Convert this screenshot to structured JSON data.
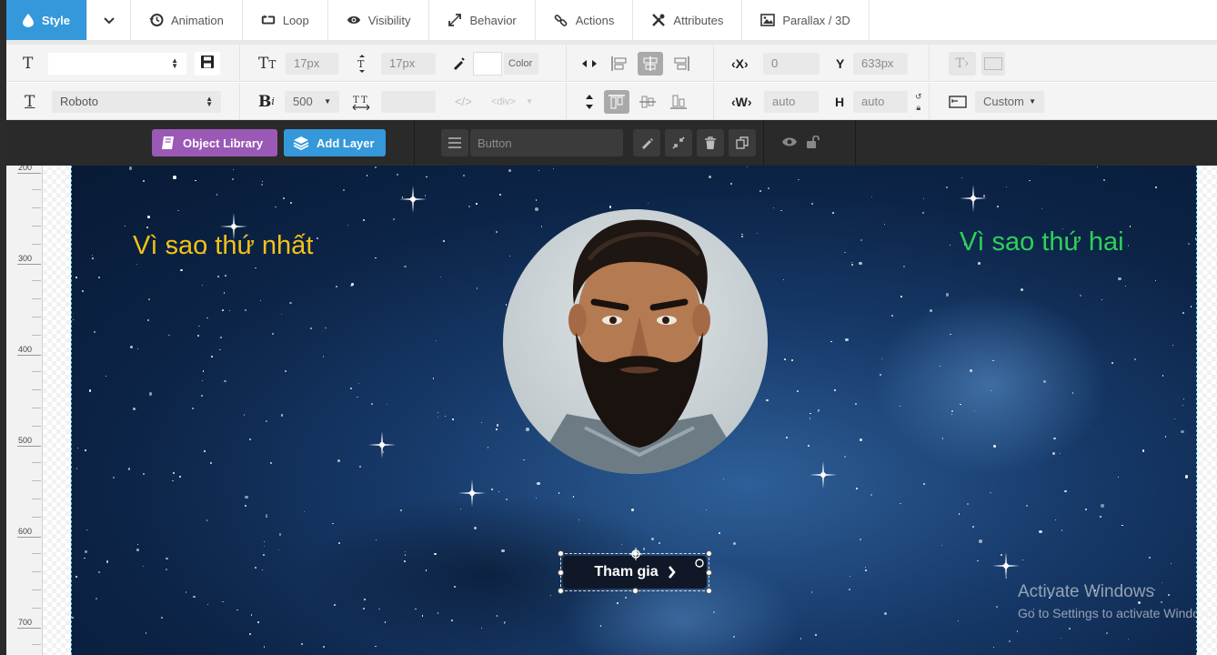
{
  "tabs": [
    {
      "label": "Style",
      "icon": "droplet-icon"
    },
    {
      "label": "",
      "icon": "chevron-down-icon"
    },
    {
      "label": "Animation",
      "icon": "history-icon"
    },
    {
      "label": "Loop",
      "icon": "loop-icon"
    },
    {
      "label": "Visibility",
      "icon": "eye-icon"
    },
    {
      "label": "Behavior",
      "icon": "expand-icon"
    },
    {
      "label": "Actions",
      "icon": "link-icon"
    },
    {
      "label": "Attributes",
      "icon": "tools-icon"
    },
    {
      "label": "Parallax / 3D",
      "icon": "image-icon"
    }
  ],
  "toolbar": {
    "row1": {
      "font_size": "17px",
      "line_height": "17px",
      "color_label": "Color",
      "x_value": "0",
      "y_value": "633px"
    },
    "row2": {
      "font_family": "Roboto",
      "font_weight": "500",
      "tag": "<div>",
      "width": "auto",
      "height": "auto",
      "size_mode": "Custom"
    }
  },
  "actionbar": {
    "object_library": "Object Library",
    "add_layer": "Add Layer",
    "layer_name": "Button"
  },
  "ruler": {
    "labels": [
      "200",
      "300",
      "400",
      "500",
      "600",
      "700"
    ]
  },
  "canvas": {
    "text_left": "Vì sao thứ nhất",
    "text_right": "Vì sao thứ hai",
    "button_label": "Tham gia",
    "text_left_color": "#f3c117",
    "text_right_color": "#2ed158"
  },
  "watermark": {
    "line1": "Activate Windows",
    "line2": "Go to Settings to activate Windows."
  },
  "colors": {
    "accent": "#3498db",
    "object_library": "#9b59b6",
    "add_layer": "#3498db"
  }
}
